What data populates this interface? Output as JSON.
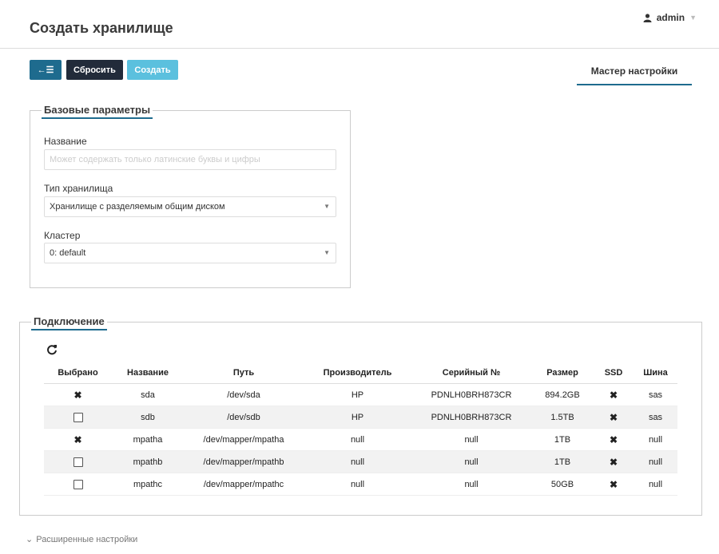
{
  "header": {
    "title": "Создать хранилище",
    "user": "admin"
  },
  "toolbar": {
    "back_icon": "←☰",
    "reset_label": "Сбросить",
    "create_label": "Создать"
  },
  "wizard_tab": "Мастер настройки",
  "basic": {
    "legend": "Базовые параметры",
    "name_label": "Название",
    "name_placeholder": "Может содержать только латинские буквы и цифры",
    "type_label": "Тип хранилища",
    "type_value": "Хранилище с разделяемым общим диском",
    "cluster_label": "Кластер",
    "cluster_value": "0: default"
  },
  "connection": {
    "legend": "Подключение",
    "columns": [
      "Выбрано",
      "Название",
      "Путь",
      "Производитель",
      "Серийный №",
      "Размер",
      "SSD",
      "Шина"
    ],
    "rows": [
      {
        "selected": true,
        "name": "sda",
        "path": "/dev/sda",
        "vendor": "HP",
        "serial": "PDNLH0BRH873CR",
        "size": "894.2GB",
        "ssd": "✖",
        "bus": "sas"
      },
      {
        "selected": false,
        "name": "sdb",
        "path": "/dev/sdb",
        "vendor": "HP",
        "serial": "PDNLH0BRH873CR",
        "size": "1.5TB",
        "ssd": "✖",
        "bus": "sas"
      },
      {
        "selected": true,
        "name": "mpatha",
        "path": "/dev/mapper/mpatha",
        "vendor": "null",
        "serial": "null",
        "size": "1TB",
        "ssd": "✖",
        "bus": "null"
      },
      {
        "selected": false,
        "name": "mpathb",
        "path": "/dev/mapper/mpathb",
        "vendor": "null",
        "serial": "null",
        "size": "1TB",
        "ssd": "✖",
        "bus": "null"
      },
      {
        "selected": false,
        "name": "mpathc",
        "path": "/dev/mapper/mpathc",
        "vendor": "null",
        "serial": "null",
        "size": "50GB",
        "ssd": "✖",
        "bus": "null"
      }
    ],
    "selected_mark": "✖"
  },
  "advanced": {
    "label": "Расширенные настройки"
  },
  "colors": {
    "primary": "#1e6b8e",
    "dark": "#222b3a",
    "info": "#5bc0de"
  }
}
